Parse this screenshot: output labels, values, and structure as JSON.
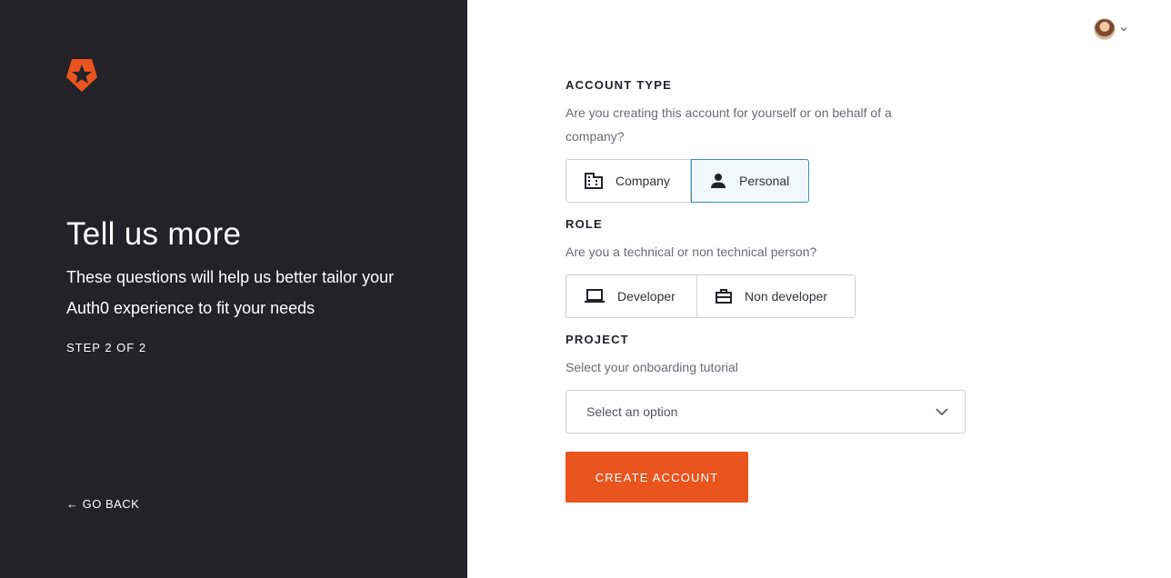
{
  "left_panel": {
    "title": "Tell us more",
    "subtitle": "These questions will help us better tailor your Auth0 experience to fit your needs",
    "step": "STEP 2 OF 2",
    "go_back": "← GO BACK",
    "logo_icon": "auth0-shield-star-icon",
    "background_color": "#222228",
    "brand_color": "#e9541f"
  },
  "account_type": {
    "label": "ACCOUNT TYPE",
    "question": "Are you creating this account for yourself or on behalf of a company?",
    "options": [
      {
        "label": "Company",
        "icon": "building-icon",
        "selected": false
      },
      {
        "label": "Personal",
        "icon": "person-icon",
        "selected": true
      }
    ]
  },
  "role": {
    "label": "ROLE",
    "question": "Are you a technical or non technical person?",
    "options": [
      {
        "label": "Developer",
        "icon": "laptop-icon",
        "selected": false
      },
      {
        "label": "Non developer",
        "icon": "briefcase-icon",
        "selected": false
      }
    ]
  },
  "project": {
    "label": "PROJECT",
    "question": "Select your onboarding tutorial",
    "select_value": "Select an option"
  },
  "submit": {
    "label": "CREATE ACCOUNT"
  },
  "colors": {
    "selected_border": "#3d8fae",
    "button": "#e9541f"
  }
}
